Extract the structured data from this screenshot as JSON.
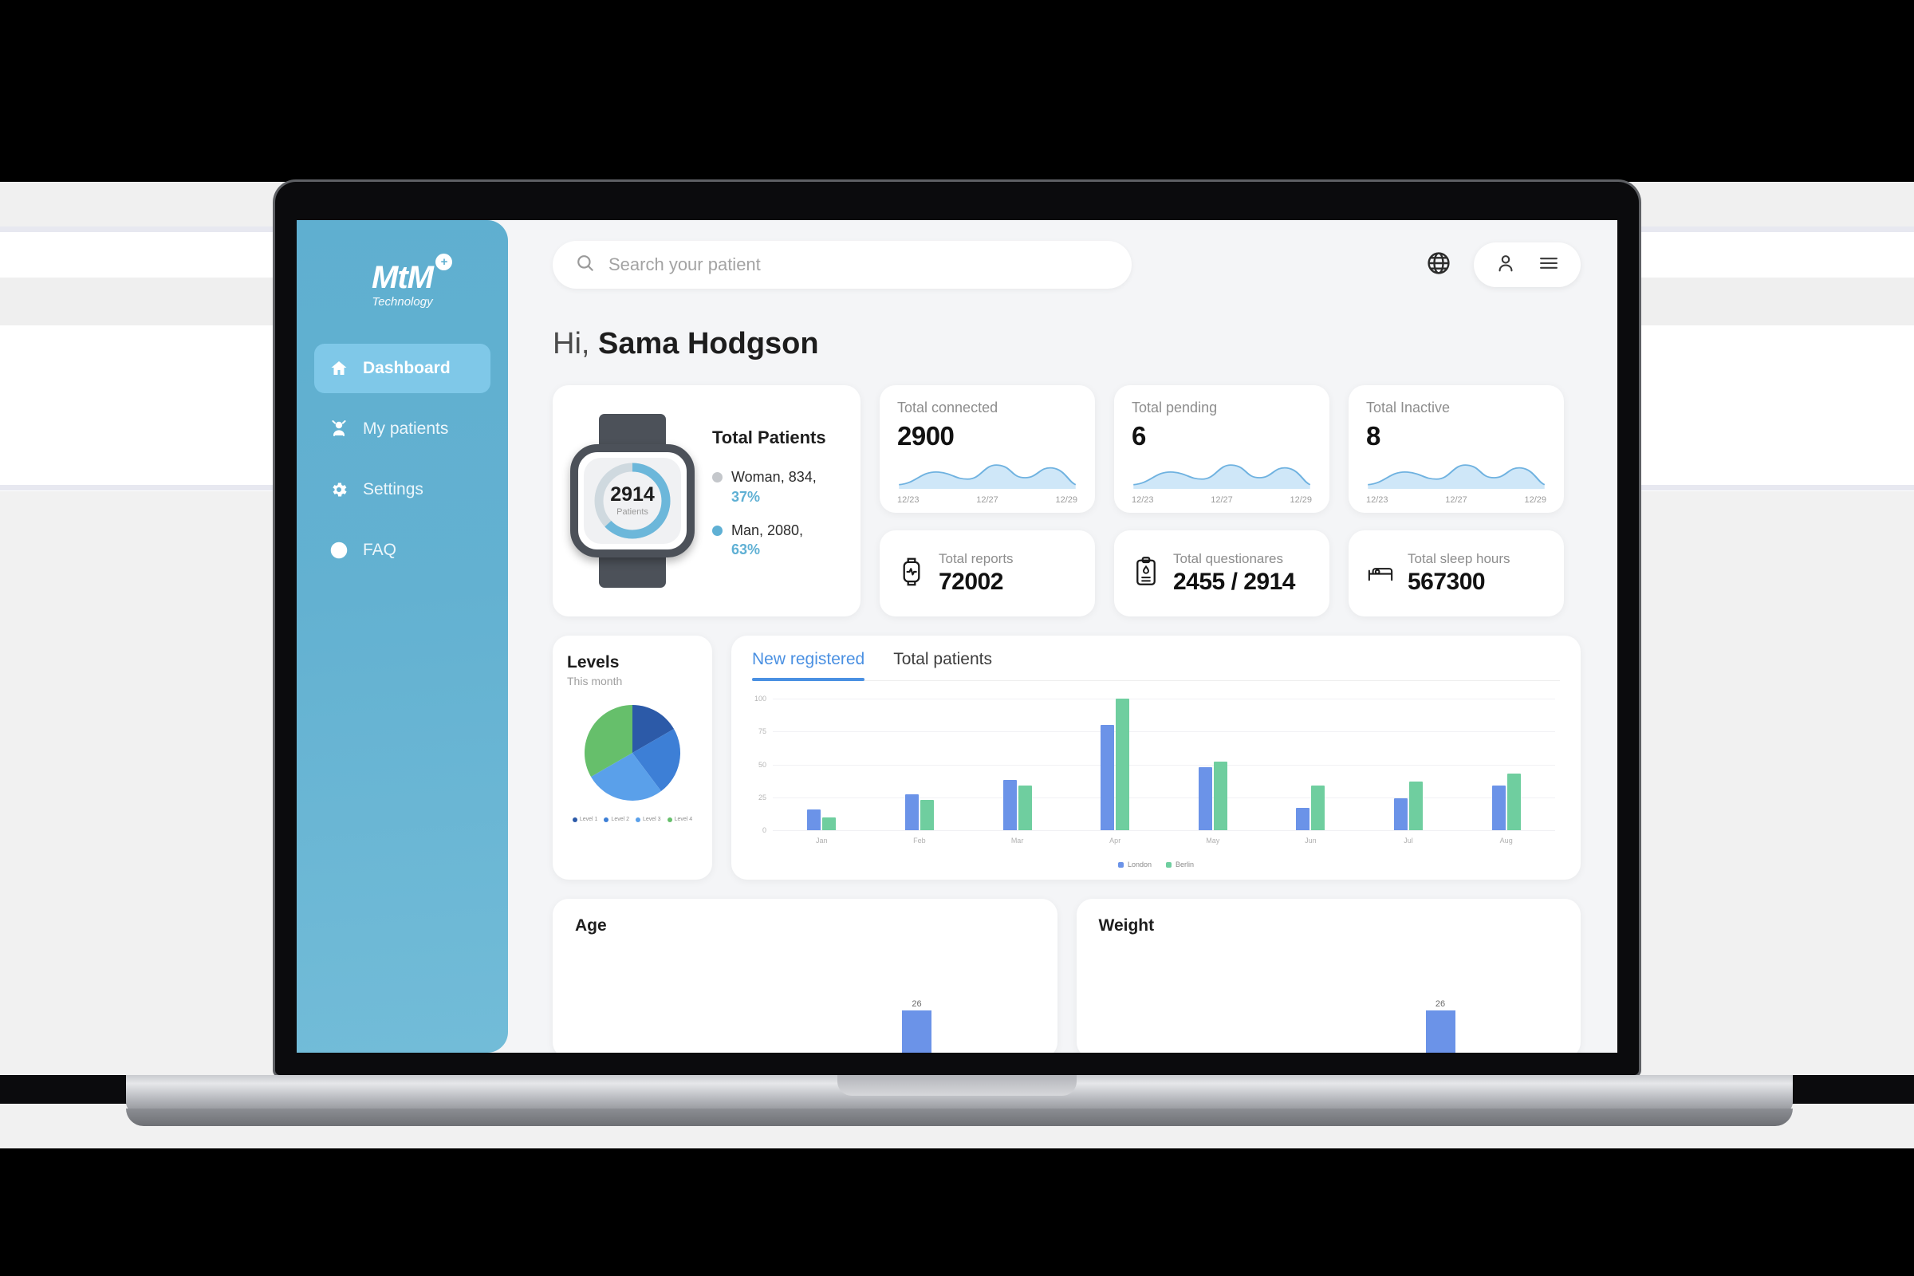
{
  "device": {
    "label": "MacBook Pro"
  },
  "brand": {
    "name": "MtM",
    "plus": "+",
    "tagline": "Technology",
    "accent": "#5fafd0",
    "sidebar_active": "#7fc8e8"
  },
  "sidebar": {
    "items": [
      {
        "label": "Dashboard",
        "icon": "home-icon",
        "active": true
      },
      {
        "label": "My patients",
        "icon": "people-icon",
        "active": false
      },
      {
        "label": "Settings",
        "icon": "gear-icon",
        "active": false
      },
      {
        "label": "FAQ",
        "icon": "question-circle-icon",
        "active": false
      }
    ]
  },
  "topbar": {
    "search_placeholder": "Search your patient",
    "search_value": "",
    "search_icon": "search-icon",
    "globe_icon": "globe-icon",
    "user_icon": "user-icon",
    "menu_icon": "hamburger-menu-icon"
  },
  "greeting": {
    "prefix": "Hi, ",
    "name": "Sama Hodgson"
  },
  "total_patients": {
    "title": "Total Patients",
    "count": "2914",
    "count_caption": "Patients",
    "legend": [
      {
        "label": "Woman, 834,",
        "pct": "37%",
        "color": "#c4c7cb"
      },
      {
        "label": "Man, 2080,",
        "pct": "63%",
        "color": "#5fb0d4"
      }
    ]
  },
  "stats_top": [
    {
      "label": "Total connected",
      "value": "2900",
      "axis": [
        "12/23",
        "12/27",
        "12/29"
      ]
    },
    {
      "label": "Total pending",
      "value": "6",
      "axis": [
        "12/23",
        "12/27",
        "12/29"
      ]
    },
    {
      "label": "Total Inactive",
      "value": "8",
      "axis": [
        "12/23",
        "12/27",
        "12/29"
      ]
    }
  ],
  "stats_bottom": [
    {
      "label": "Total reports",
      "value": "72002",
      "icon": "smartwatch-heartbeat-icon"
    },
    {
      "label": "Total questionares",
      "value": "2455 / 2914",
      "icon": "clipboard-icon"
    },
    {
      "label": "Total sleep hours",
      "value": "567300",
      "icon": "bed-icon"
    }
  ],
  "levels": {
    "title": "Levels",
    "subtitle": "This month"
  },
  "chart_tabs": [
    {
      "label": "New registered",
      "active": true
    },
    {
      "label": "Total patients",
      "active": false
    }
  ],
  "mini_cards": [
    {
      "title": "Age",
      "bar_value": "26"
    },
    {
      "title": "Weight",
      "bar_value": "26"
    }
  ],
  "chart_data": [
    {
      "type": "pie",
      "title": "Levels",
      "subtitle": "This month",
      "legend_position": "bottom",
      "slices": [
        {
          "label": "Level 1",
          "value": 18,
          "color": "#2c5aa8"
        },
        {
          "label": "Level 2",
          "value": 17,
          "color": "#3d7fd6"
        },
        {
          "label": "Level 3",
          "value": 30,
          "color": "#5aa0ea"
        },
        {
          "label": "Level 4",
          "value": 35,
          "color": "#66bf6b"
        }
      ]
    },
    {
      "type": "bar",
      "title": "New registered",
      "categories": [
        "Jan",
        "Feb",
        "Mar",
        "Apr",
        "May",
        "Jun",
        "Jul",
        "Aug"
      ],
      "series": [
        {
          "name": "London",
          "color": "#6b93e8",
          "values": [
            16,
            27,
            38,
            80,
            48,
            17,
            24,
            34
          ]
        },
        {
          "name": "Berlin",
          "color": "#6fce9f",
          "values": [
            10,
            23,
            34,
            100,
            52,
            34,
            37,
            43
          ]
        }
      ],
      "ylim": [
        0,
        100
      ],
      "yticks": [
        "100",
        "75",
        "50",
        "25",
        "0"
      ],
      "xlabel": "",
      "ylabel": "",
      "grid": true,
      "legend_position": "bottom"
    },
    {
      "type": "bar",
      "title": "Age",
      "categories": [
        "26"
      ],
      "values": [
        26
      ],
      "xlabel": "",
      "ylabel": ""
    },
    {
      "type": "bar",
      "title": "Weight",
      "categories": [
        "26"
      ],
      "values": [
        26
      ],
      "xlabel": "",
      "ylabel": ""
    },
    {
      "type": "area",
      "title": "Total connected",
      "x": [
        "12/23",
        "12/27",
        "12/29"
      ],
      "values": [
        10,
        38,
        22,
        55,
        18,
        46,
        8
      ],
      "ylabel": ""
    },
    {
      "type": "area",
      "title": "Total pending",
      "x": [
        "12/23",
        "12/27",
        "12/29"
      ],
      "values": [
        8,
        36,
        20,
        52,
        16,
        44,
        6
      ],
      "ylabel": ""
    },
    {
      "type": "area",
      "title": "Total Inactive",
      "x": [
        "12/23",
        "12/27",
        "12/29"
      ],
      "values": [
        9,
        37,
        21,
        54,
        17,
        45,
        7
      ],
      "ylabel": ""
    }
  ]
}
